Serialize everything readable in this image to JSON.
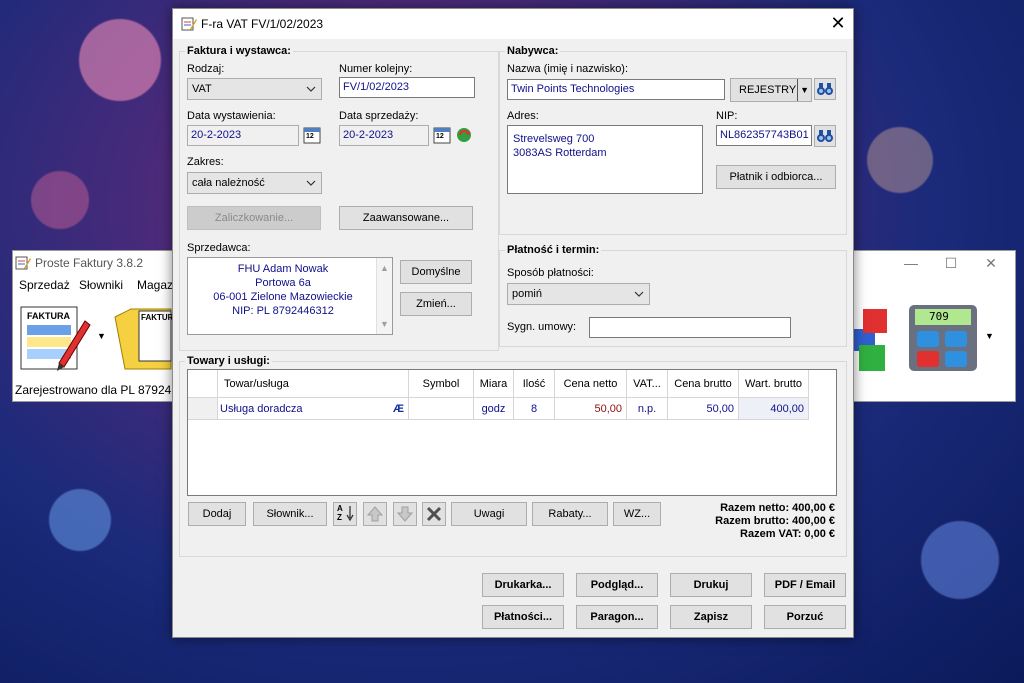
{
  "background_app": {
    "title": "Proste Faktury 3.8.2",
    "menu": [
      "Sprzedaż",
      "Słowniki",
      "Magaz"
    ],
    "toolbar": {
      "invoice_tile_label": "FAKTURA",
      "invoices_tile_label": "FAKTURA",
      "calculator_display": "709"
    },
    "status": "Zarejestrowano dla PL 87924"
  },
  "dialog": {
    "title": "F-ra VAT FV/1/02/2023",
    "invoice_group": {
      "title": "Faktura i wystawca:",
      "type_label": "Rodzaj:",
      "type_value": "VAT",
      "number_label": "Numer kolejny:",
      "number_value": "FV/1/02/2023",
      "issue_date_label": "Data wystawienia:",
      "issue_date_value": "20-2-2023",
      "sale_date_label": "Data sprzedaży:",
      "sale_date_value": "20-2-2023",
      "scope_label": "Zakres:",
      "scope_value": "cała należność",
      "advance_button": "Zaliczkowanie...",
      "advanced_button": "Zaawansowane...",
      "calendar_day": "12",
      "seller_label": "Sprzedawca:",
      "seller_lines": [
        "FHU Adam Nowak",
        "Portowa 6a",
        "06-001 Zielone Mazowieckie",
        "NIP: PL 8792446312"
      ],
      "default_button": "Domyślne",
      "change_button": "Zmień..."
    },
    "buyer_group": {
      "title": "Nabywca:",
      "name_label": "Nazwa (imię i nazwisko):",
      "name_value": "Twin Points Technologies",
      "registry_button": "REJESTRY",
      "address_label": "Adres:",
      "address_lines": [
        "Strevelsweg 700",
        "3083AS Rotterdam"
      ],
      "nip_label": "NIP:",
      "nip_value": "NL862357743B01",
      "payer_button": "Płatnik i odbiorca..."
    },
    "payment_group": {
      "title": "Płatność i termin:",
      "method_label": "Sposób płatności:",
      "method_value": "pomiń",
      "contract_label": "Sygn. umowy:",
      "contract_value": ""
    },
    "items_group": {
      "title": "Towary i usługi:",
      "columns": [
        "Towar/usługa",
        "Symbol",
        "Miara",
        "Ilość",
        "Cena netto",
        "VAT...",
        "Cena brutto",
        "Wart. brutto"
      ],
      "rows": [
        {
          "name": "Usługa doradcza",
          "glyph": "Æ",
          "symbol": "",
          "unit": "godz",
          "qty": "8",
          "net": "50,00",
          "vat": "n.p.",
          "gross": "50,00",
          "total": "400,00"
        }
      ],
      "add_button": "Dodaj",
      "dictionary_button": "Słownik...",
      "notes_button": "Uwagi",
      "discounts_button": "Rabaty...",
      "wz_button": "WZ...",
      "sort_glyph": "AZ",
      "total_net": "Razem netto: 400,00 €",
      "total_gross": "Razem brutto: 400,00 €",
      "total_vat": "Razem VAT: 0,00 €"
    },
    "actions": {
      "printer": "Drukarka...",
      "preview": "Podgląd...",
      "print": "Drukuj",
      "pdf_email": "PDF / Email",
      "payments": "Płatności...",
      "receipt": "Paragon...",
      "save": "Zapisz",
      "discard": "Porzuć"
    }
  }
}
